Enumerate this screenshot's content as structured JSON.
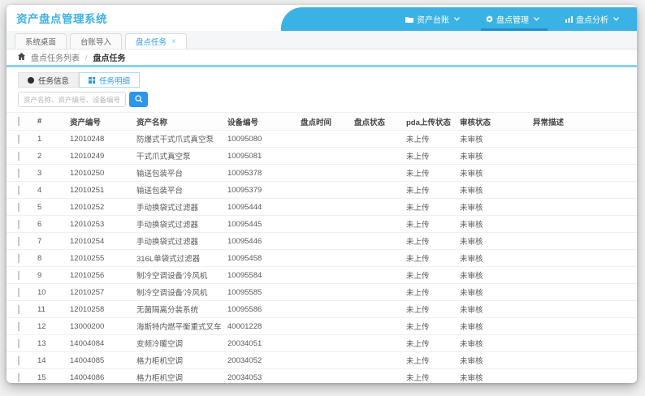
{
  "header": {
    "title": "资产盘点管理系统",
    "nav": [
      {
        "label": "资产台账",
        "icon": "folder-icon"
      },
      {
        "label": "盘点管理",
        "icon": "gear-icon",
        "active": true
      },
      {
        "label": "盘点分析",
        "icon": "chart-icon"
      }
    ]
  },
  "tabs": [
    {
      "label": "系统桌面"
    },
    {
      "label": "台账导入"
    },
    {
      "label": "盘点任务",
      "active": true,
      "close": "×"
    }
  ],
  "breadcrumb": {
    "items": [
      "盘点任务列表",
      "盘点任务"
    ]
  },
  "subtabs": [
    {
      "label": "任务信息",
      "icon": "info-circle-icon"
    },
    {
      "label": "任务明细",
      "icon": "grid-icon",
      "active": true
    }
  ],
  "search": {
    "placeholder": "资产名称、资产编号、设备编号"
  },
  "table": {
    "columns": [
      "#",
      "资产编号",
      "资产名称",
      "设备编号",
      "盘点时间",
      "盘点状态",
      "pda上传状态",
      "审核状态",
      "异常描述"
    ],
    "rows": [
      {
        "num": "1",
        "asset_no": "12010248",
        "asset_name": "防爆式干式爪式真空泵",
        "device_no": "10095080",
        "inv_time": "",
        "inv_status": "",
        "pda_status": "未上传",
        "audit_status": "未审核",
        "exception": ""
      },
      {
        "num": "2",
        "asset_no": "12010249",
        "asset_name": "干式爪式真空泵",
        "device_no": "10095081",
        "inv_time": "",
        "inv_status": "",
        "pda_status": "未上传",
        "audit_status": "未审核",
        "exception": ""
      },
      {
        "num": "3",
        "asset_no": "12010250",
        "asset_name": "输送包装平台",
        "device_no": "10095378",
        "inv_time": "",
        "inv_status": "",
        "pda_status": "未上传",
        "audit_status": "未审核",
        "exception": ""
      },
      {
        "num": "4",
        "asset_no": "12010251",
        "asset_name": "输送包装平台",
        "device_no": "10095379",
        "inv_time": "",
        "inv_status": "",
        "pda_status": "未上传",
        "audit_status": "未审核",
        "exception": ""
      },
      {
        "num": "5",
        "asset_no": "12010252",
        "asset_name": "手动换袋式过滤器",
        "device_no": "10095444",
        "inv_time": "",
        "inv_status": "",
        "pda_status": "未上传",
        "audit_status": "未审核",
        "exception": ""
      },
      {
        "num": "6",
        "asset_no": "12010253",
        "asset_name": "手动换袋式过滤器",
        "device_no": "10095445",
        "inv_time": "",
        "inv_status": "",
        "pda_status": "未上传",
        "audit_status": "未审核",
        "exception": ""
      },
      {
        "num": "7",
        "asset_no": "12010254",
        "asset_name": "手动换袋式过滤器",
        "device_no": "10095446",
        "inv_time": "",
        "inv_status": "",
        "pda_status": "未上传",
        "audit_status": "未审核",
        "exception": ""
      },
      {
        "num": "8",
        "asset_no": "12010255",
        "asset_name": "316L单袋式过滤器",
        "device_no": "10095458",
        "inv_time": "",
        "inv_status": "",
        "pda_status": "未上传",
        "audit_status": "未审核",
        "exception": ""
      },
      {
        "num": "9",
        "asset_no": "12010256",
        "asset_name": "制冷空调设备'冷风机",
        "device_no": "10095584",
        "inv_time": "",
        "inv_status": "",
        "pda_status": "未上传",
        "audit_status": "未审核",
        "exception": ""
      },
      {
        "num": "10",
        "asset_no": "12010257",
        "asset_name": "制冷空调设备'冷风机",
        "device_no": "10095585",
        "inv_time": "",
        "inv_status": "",
        "pda_status": "未上传",
        "audit_status": "未审核",
        "exception": ""
      },
      {
        "num": "11",
        "asset_no": "12010258",
        "asset_name": "无菌隔离分装系统",
        "device_no": "10095586",
        "inv_time": "",
        "inv_status": "",
        "pda_status": "未上传",
        "audit_status": "未审核",
        "exception": ""
      },
      {
        "num": "12",
        "asset_no": "13000200",
        "asset_name": "海斯特内燃平衡重式叉车",
        "device_no": "40001228",
        "inv_time": "",
        "inv_status": "",
        "pda_status": "未上传",
        "audit_status": "未审核",
        "exception": ""
      },
      {
        "num": "13",
        "asset_no": "14004084",
        "asset_name": "变频冷暖空调",
        "device_no": "20034051",
        "inv_time": "",
        "inv_status": "",
        "pda_status": "未上传",
        "audit_status": "未审核",
        "exception": ""
      },
      {
        "num": "14",
        "asset_no": "14004085",
        "asset_name": "格力柜机空调",
        "device_no": "20034052",
        "inv_time": "",
        "inv_status": "",
        "pda_status": "未上传",
        "audit_status": "未审核",
        "exception": ""
      },
      {
        "num": "15",
        "asset_no": "14004086",
        "asset_name": "格力柜机空调",
        "device_no": "20034053",
        "inv_time": "",
        "inv_status": "",
        "pda_status": "未上传",
        "audit_status": "未审核",
        "exception": ""
      }
    ]
  }
}
